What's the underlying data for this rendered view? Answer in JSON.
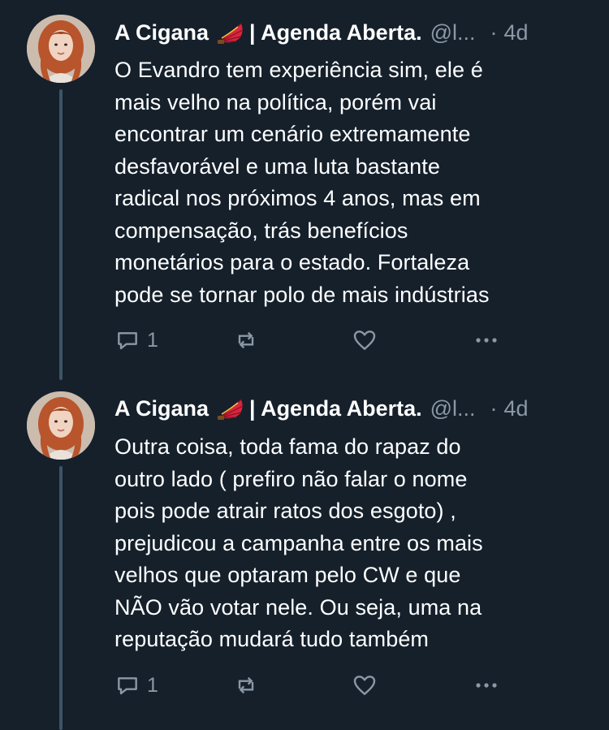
{
  "tweets": [
    {
      "author_name": "A Cigana",
      "author_suffix": "| Agenda Aberta.",
      "handle": "@l...",
      "separator": "·",
      "time": "4d",
      "text": "O Evandro tem experiência sim, ele é\nmais velho na política, porém vai\nencontrar um cenário extremamente\ndesfavorável e uma luta bastante\nradical nos próximos 4 anos, mas em\ncompensação, trás benefícios\nmonetários para o estado. Fortaleza\npode se tornar polo de mais indústrias",
      "reply_count": "1",
      "icons": [
        "reply-icon",
        "retweet-icon",
        "like-icon",
        "more-icon"
      ]
    },
    {
      "author_name": "A Cigana",
      "author_suffix": "| Agenda Aberta.",
      "handle": "@l...",
      "separator": "·",
      "time": "4d",
      "text": "Outra coisa, toda fama do rapaz do\noutro lado ( prefiro não falar o nome\npois pode atrair ratos dos esgoto) ,\nprejudicou a campanha entre os mais\nvelhos que optaram pelo CW e que\nNÃO vão votar nele. Ou seja, uma na\nreputação mudará tudo também",
      "reply_count": "1",
      "icons": [
        "reply-icon",
        "retweet-icon",
        "like-icon",
        "more-icon"
      ]
    }
  ],
  "colors": {
    "background": "#15202b",
    "text_primary": "#ffffff",
    "text_secondary": "#8b98a5",
    "thread_line": "#3d5466",
    "fan_red": "#d7263d"
  }
}
